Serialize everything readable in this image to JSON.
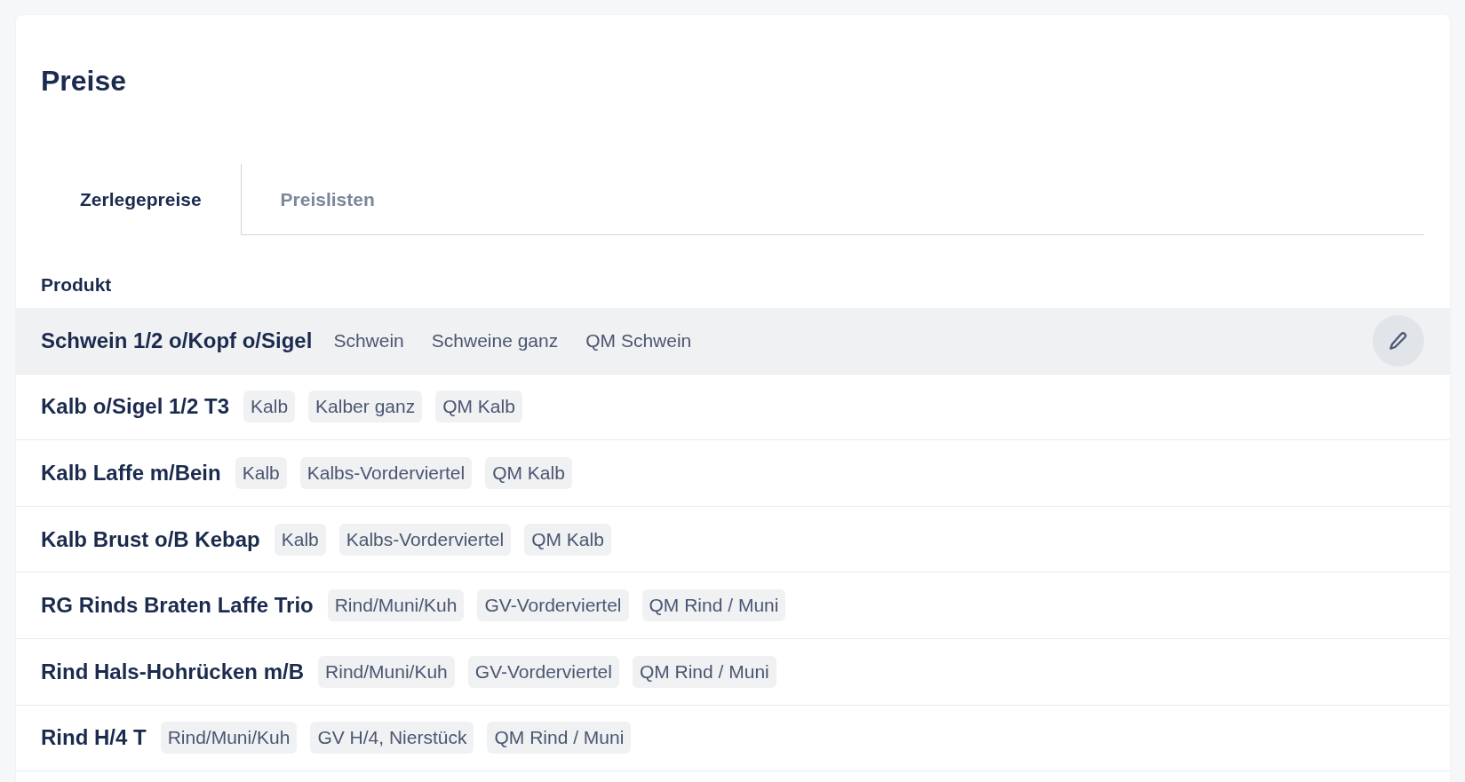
{
  "page": {
    "title": "Preise"
  },
  "tabs": [
    {
      "label": "Zerlegepreise",
      "selected": true
    },
    {
      "label": "Preislisten",
      "selected": false
    }
  ],
  "table": {
    "columns": [
      "Produkt"
    ],
    "rows": [
      {
        "product": "Schwein 1/2 o/Kopf o/Sigel",
        "tags": [
          "Schwein",
          "Schweine ganz",
          "QM Schwein"
        ],
        "hovered": true
      },
      {
        "product": "Kalb o/Sigel 1/2 T3",
        "tags": [
          "Kalb",
          "Kalber ganz",
          "QM Kalb"
        ],
        "hovered": false
      },
      {
        "product": "Kalb Laffe m/Bein",
        "tags": [
          "Kalb",
          "Kalbs-Vorderviertel",
          "QM Kalb"
        ],
        "hovered": false
      },
      {
        "product": "Kalb Brust o/B Kebap",
        "tags": [
          "Kalb",
          "Kalbs-Vorderviertel",
          "QM Kalb"
        ],
        "hovered": false
      },
      {
        "product": "RG Rinds Braten Laffe Trio",
        "tags": [
          "Rind/Muni/Kuh",
          "GV-Vorderviertel",
          "QM Rind / Muni"
        ],
        "hovered": false
      },
      {
        "product": "Rind Hals-Hohrücken m/B",
        "tags": [
          "Rind/Muni/Kuh",
          "GV-Vorderviertel",
          "QM Rind / Muni"
        ],
        "hovered": false
      },
      {
        "product": "Rind H/4 T",
        "tags": [
          "Rind/Muni/Kuh",
          "GV H/4, Nierstück",
          "QM Rind / Muni"
        ],
        "hovered": false
      }
    ]
  }
}
